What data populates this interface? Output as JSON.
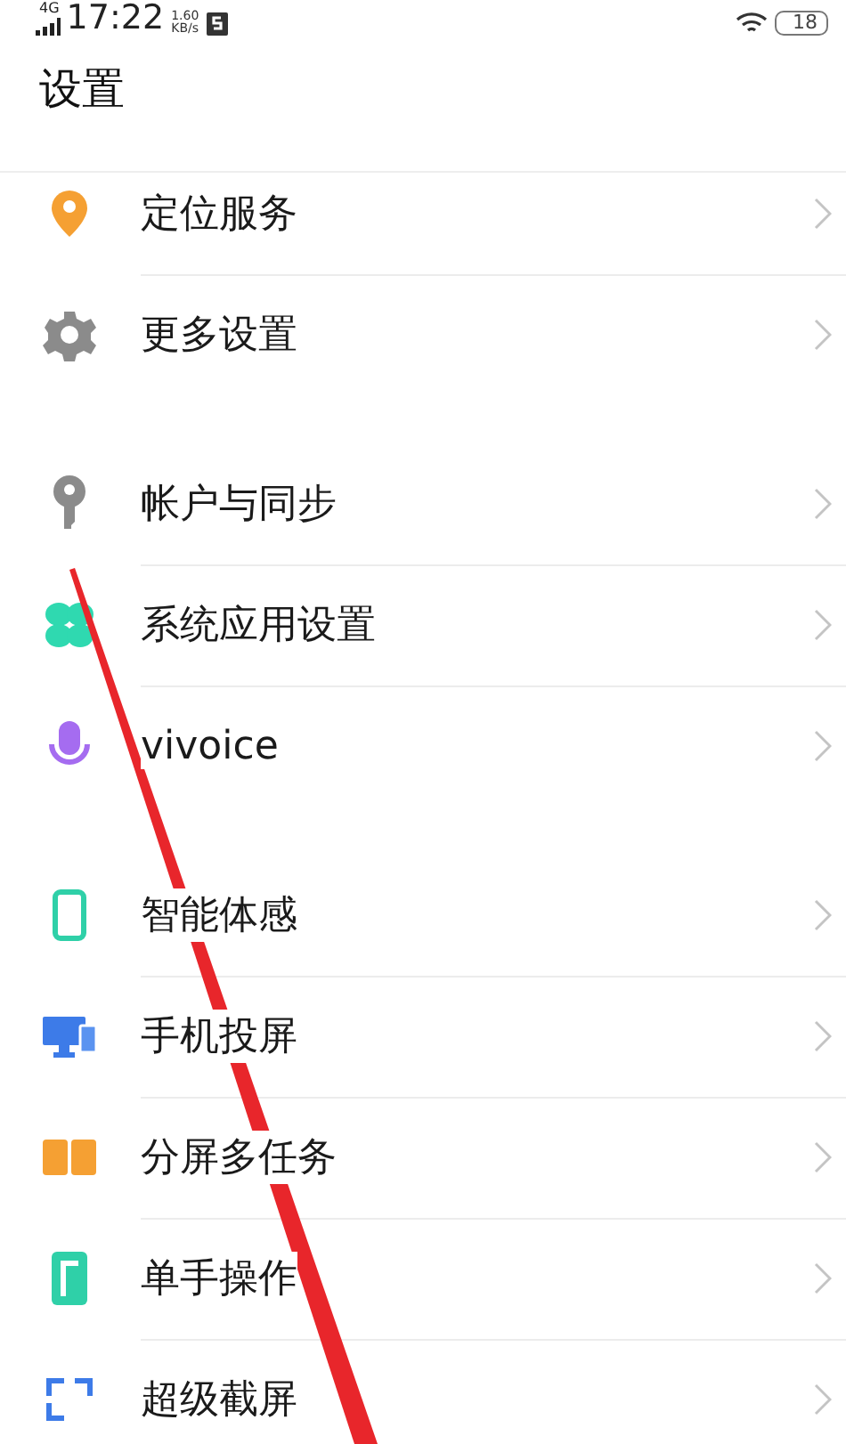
{
  "status_bar": {
    "network": "4G",
    "time": "17:22",
    "speed_value": "1.60",
    "speed_unit": "KB/s",
    "battery": "18"
  },
  "title": "设置",
  "groups": [
    {
      "items": [
        {
          "label": "定位服务"
        },
        {
          "label": "更多设置"
        }
      ]
    },
    {
      "items": [
        {
          "label": "帐户与同步"
        },
        {
          "label": "系统应用设置"
        },
        {
          "label": "vivoice"
        }
      ]
    },
    {
      "items": [
        {
          "label": "智能体感"
        },
        {
          "label": "手机投屏"
        },
        {
          "label": "分屏多任务"
        },
        {
          "label": "单手操作"
        },
        {
          "label": "超级截屏"
        }
      ]
    }
  ]
}
